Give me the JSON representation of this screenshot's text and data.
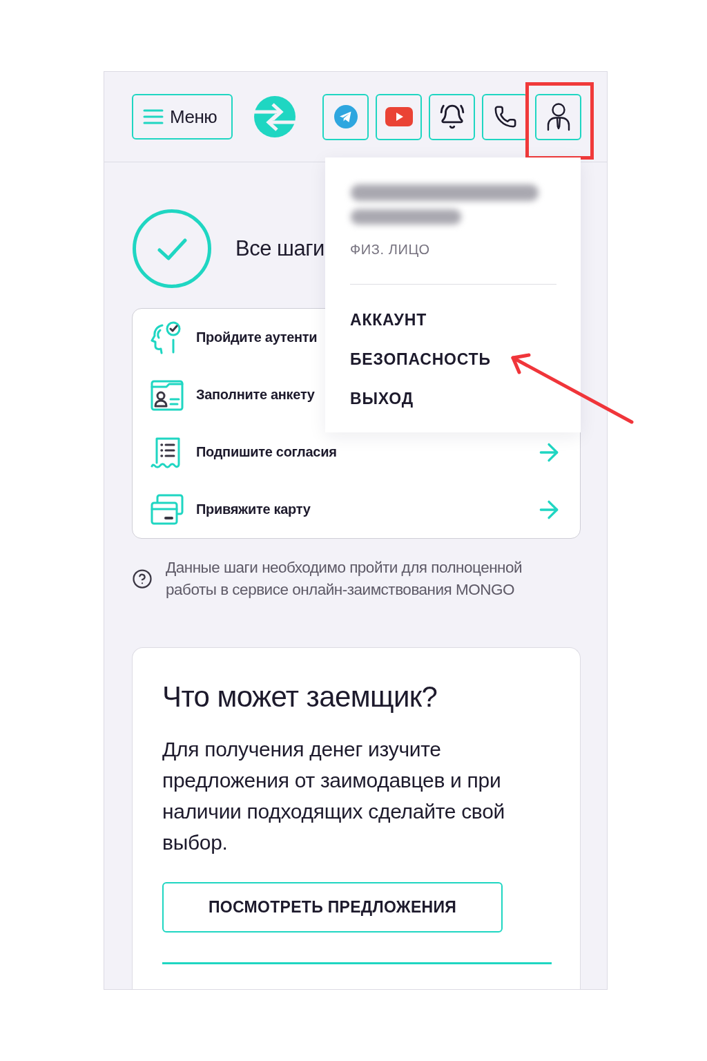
{
  "header": {
    "menu_button": {
      "label": "Меню"
    },
    "buttons": [
      {
        "kind": "plane",
        "highlighted": false
      },
      {
        "kind": "play",
        "highlighted": false
      },
      {
        "kind": "bell",
        "highlighted": false
      },
      {
        "kind": "phone",
        "highlighted": false
      },
      {
        "kind": "person",
        "highlighted": true
      }
    ]
  },
  "profile_menu": {
    "open": true,
    "account_type": "ФИЗ. ЛИЦО",
    "items": [
      {
        "label": "АККАУНТ",
        "pointed": false
      },
      {
        "label": "БЕЗОПАСНОСТЬ",
        "pointed": true
      },
      {
        "label": "ВЫХОД",
        "pointed": false
      }
    ]
  },
  "status": {
    "title": "Все шаги"
  },
  "steps": [
    {
      "kind": "face-check",
      "label": "Пройдите аутенти",
      "arrow": false
    },
    {
      "kind": "id-card",
      "label": "Заполните анкету",
      "arrow": false
    },
    {
      "kind": "document",
      "label": "Подпишите согласия",
      "arrow": true
    },
    {
      "kind": "cards",
      "label": "Привяжите карту",
      "arrow": true
    }
  ],
  "help_note": "Данные шаги необходимо пройти для полноценной работы в сервисе онлайн-заимствования MONGO",
  "borrower_card": {
    "title": "Что может заемщик?",
    "text": "Для получения денег изучите предложения от заимодавцев и при наличии подходящих сделайте свой выбор.",
    "button": "ПОСМОТРЕТЬ ПРЕДЛОЖЕНИЯ"
  }
}
